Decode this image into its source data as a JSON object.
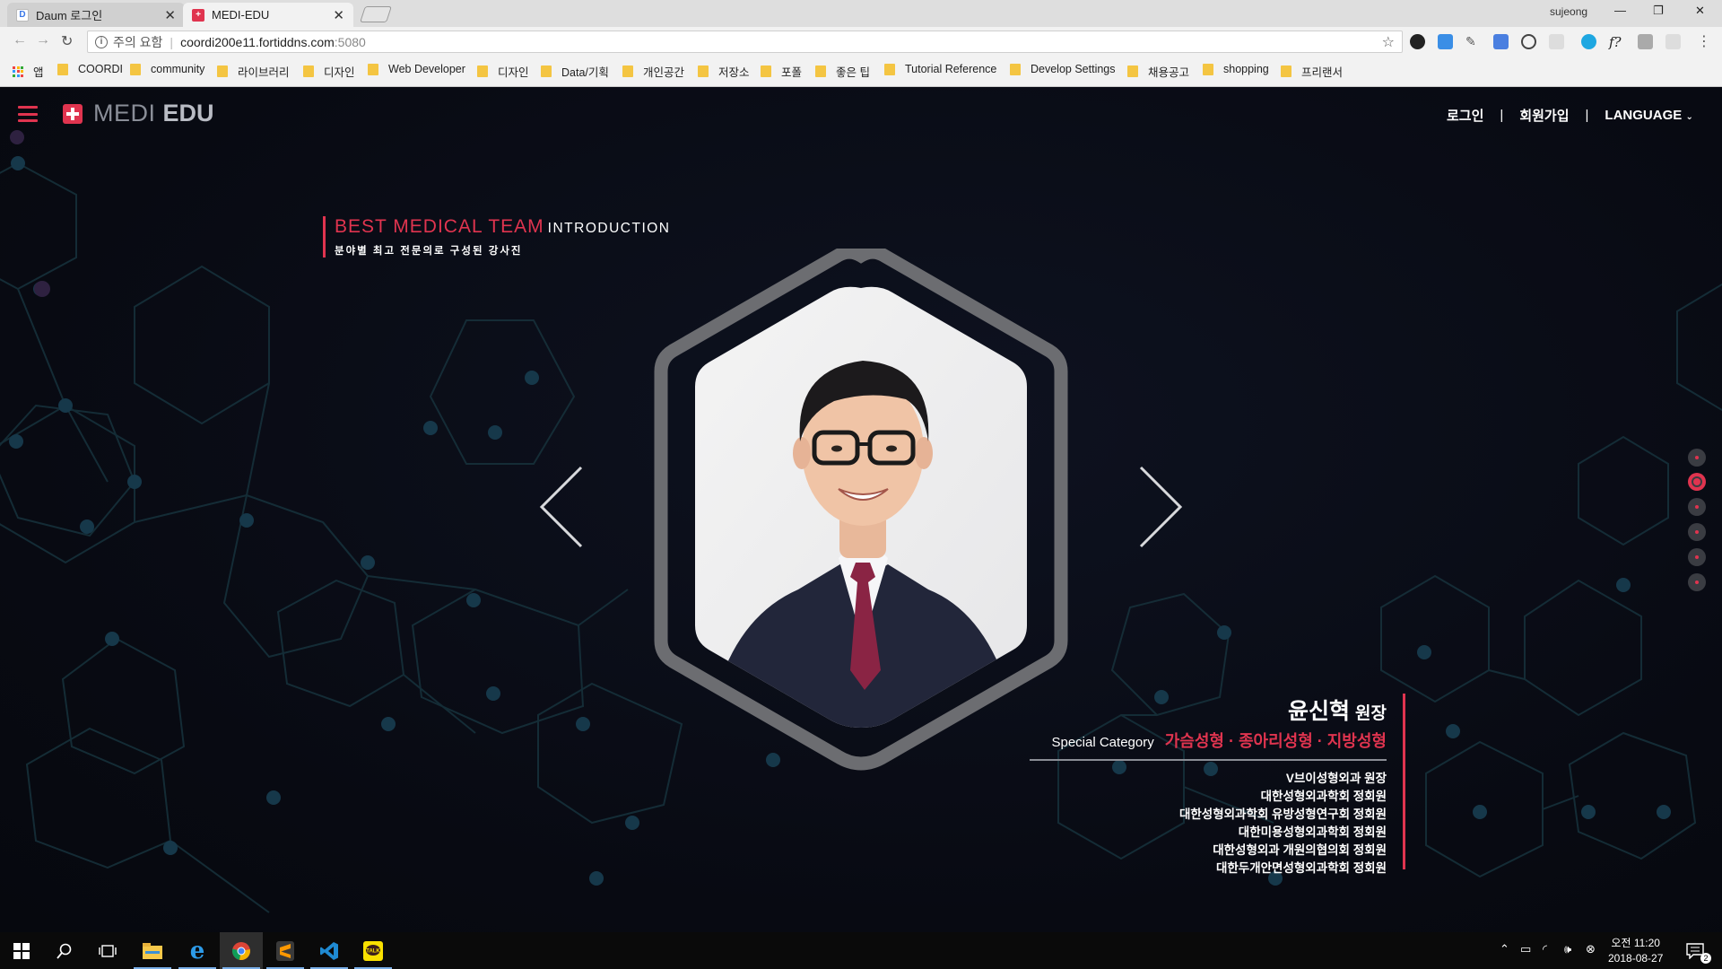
{
  "browser": {
    "tabs": [
      {
        "title": "Daum 로그인",
        "icon": "daum-favicon",
        "active": false
      },
      {
        "title": "MEDI-EDU",
        "icon": "medi-edu-favicon",
        "active": true
      }
    ],
    "profile_name": "sujeong",
    "address": {
      "security_label": "주의 요함",
      "host": "coordi200e11.fortiddns.com",
      "port": ":5080"
    },
    "bookmarks": [
      {
        "label": "앱",
        "type": "apps"
      },
      {
        "label": "COORDI",
        "type": "folder"
      },
      {
        "label": "community",
        "type": "folder"
      },
      {
        "label": "라이브러리",
        "type": "folder"
      },
      {
        "label": "디자인",
        "type": "folder"
      },
      {
        "label": "Web Developer",
        "type": "folder"
      },
      {
        "label": "디자인",
        "type": "folder"
      },
      {
        "label": "Data/기획",
        "type": "folder"
      },
      {
        "label": "개인공간",
        "type": "folder"
      },
      {
        "label": "저장소",
        "type": "folder"
      },
      {
        "label": "포폴",
        "type": "folder"
      },
      {
        "label": "좋은 팁",
        "type": "folder"
      },
      {
        "label": "Tutorial Reference",
        "type": "folder"
      },
      {
        "label": "Develop Settings",
        "type": "folder"
      },
      {
        "label": "채용공고",
        "type": "folder"
      },
      {
        "label": "shopping",
        "type": "folder"
      },
      {
        "label": "프리랜서",
        "type": "folder"
      }
    ]
  },
  "site": {
    "logo": {
      "part1": "MEDI",
      "part2": "EDU"
    },
    "nav": {
      "login": "로그인",
      "divider": "|",
      "signup": "회원가입",
      "language": "LANGUAGE"
    },
    "intro": {
      "title_highlight": "BEST MEDICAL TEAM",
      "title_rest": "INTRODUCTION",
      "subtitle": "분야별 최고 전문의로 구성된 강사진"
    },
    "doctor": {
      "name": "윤신혁",
      "title": "원장",
      "category_label": "Special Category",
      "category_value": "가슴성형 · 종아리성형 · 지방성형",
      "career": [
        "V브이성형외과 원장",
        "대한성형외과학회 정회원",
        "대한성형외과학회 유방성형연구회 정회원",
        "대한미용성형외과학회 정회원",
        "대한성형외과 개원의협의회 정회원",
        "대한두개안면성형외과학회 정회원"
      ]
    },
    "slider": {
      "total": 6,
      "active_index": 2
    },
    "accent_color": "#e0344f"
  },
  "taskbar": {
    "apps": [
      "windows-start-icon",
      "search-icon",
      "task-view-icon",
      "file-explorer-icon",
      "internet-explorer-icon",
      "chrome-icon",
      "sublime-text-icon",
      "vscode-icon",
      "kakaotalk-icon"
    ],
    "clock": {
      "time": "오전 11:20",
      "date": "2018-08-27"
    },
    "notification_count": "2"
  }
}
